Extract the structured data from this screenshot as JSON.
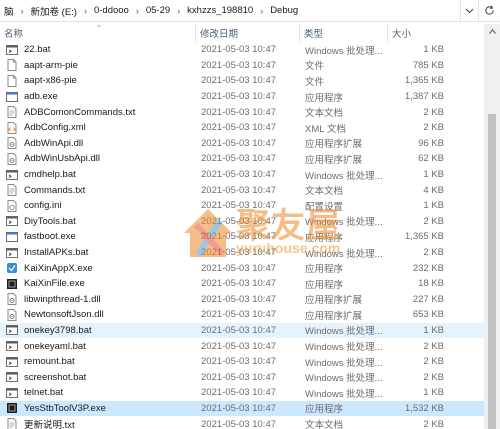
{
  "address": {
    "crumbs": [
      "脑",
      "新加卷 (E:)",
      "0-ddooo",
      "05-29",
      "kxhzzs_198810",
      "Debug"
    ]
  },
  "columns": {
    "name": "名称",
    "date": "修改日期",
    "type": "类型",
    "size": "大小"
  },
  "files": [
    {
      "name": "22.bat",
      "date": "2021-05-03 10:47",
      "type": "Windows 批处理...",
      "size": "1 KB",
      "icon": "bat-icon"
    },
    {
      "name": "aapt-arm-pie",
      "date": "2021-05-03 10:47",
      "type": "文件",
      "size": "785 KB",
      "icon": "blank-file-icon"
    },
    {
      "name": "aapt-x86-pie",
      "date": "2021-05-03 10:47",
      "type": "文件",
      "size": "1,365 KB",
      "icon": "blank-file-icon"
    },
    {
      "name": "adb.exe",
      "date": "2021-05-03 10:47",
      "type": "应用程序",
      "size": "1,387 KB",
      "icon": "exe-icon"
    },
    {
      "name": "ADBComonCommands.txt",
      "date": "2021-05-03 10:47",
      "type": "文本文档",
      "size": "2 KB",
      "icon": "text-file-icon"
    },
    {
      "name": "AdbConfig.xml",
      "date": "2021-05-03 10:47",
      "type": "XML 文档",
      "size": "2 KB",
      "icon": "xml-file-icon"
    },
    {
      "name": "AdbWinApi.dll",
      "date": "2021-05-03 10:47",
      "type": "应用程序扩展",
      "size": "96 KB",
      "icon": "dll-icon"
    },
    {
      "name": "AdbWinUsbApi.dll",
      "date": "2021-05-03 10:47",
      "type": "应用程序扩展",
      "size": "62 KB",
      "icon": "dll-icon"
    },
    {
      "name": "cmdhelp.bat",
      "date": "2021-05-03 10:47",
      "type": "Windows 批处理...",
      "size": "1 KB",
      "icon": "bat-icon"
    },
    {
      "name": "Commands.txt",
      "date": "2021-05-03 10:47",
      "type": "文本文档",
      "size": "4 KB",
      "icon": "text-file-icon"
    },
    {
      "name": "config.ini",
      "date": "2021-05-03 10:47",
      "type": "配置设置",
      "size": "1 KB",
      "icon": "ini-file-icon"
    },
    {
      "name": "DiyTools.bat",
      "date": "2021-05-03 10:47",
      "type": "Windows 批处理...",
      "size": "2 KB",
      "icon": "bat-icon"
    },
    {
      "name": "fastboot.exe",
      "date": "2021-05-03 10:47",
      "type": "应用程序",
      "size": "1,365 KB",
      "icon": "exe-icon"
    },
    {
      "name": "InstallAPKs.bat",
      "date": "2021-05-03 10:47",
      "type": "Windows 批处理...",
      "size": "2 KB",
      "icon": "bat-icon"
    },
    {
      "name": "KaiXinAppX.exe",
      "date": "2021-05-03 10:47",
      "type": "应用程序",
      "size": "232 KB",
      "icon": "app-icon"
    },
    {
      "name": "KaiXinFile.exe",
      "date": "2021-05-03 10:47",
      "type": "应用程序",
      "size": "18 KB",
      "icon": "dark-app-icon"
    },
    {
      "name": "libwinpthread-1.dll",
      "date": "2021-05-03 10:47",
      "type": "应用程序扩展",
      "size": "227 KB",
      "icon": "dll-icon"
    },
    {
      "name": "NewtonsoftJson.dll",
      "date": "2021-05-03 10:47",
      "type": "应用程序扩展",
      "size": "653 KB",
      "icon": "dll-icon"
    },
    {
      "name": "onekey3798.bat",
      "date": "2021-05-03 10:47",
      "type": "Windows 批处理...",
      "size": "1 KB",
      "icon": "bat-icon"
    },
    {
      "name": "onekeyaml.bat",
      "date": "2021-05-03 10:47",
      "type": "Windows 批处理...",
      "size": "2 KB",
      "icon": "bat-icon"
    },
    {
      "name": "remount.bat",
      "date": "2021-05-03 10:47",
      "type": "Windows 批处理...",
      "size": "2 KB",
      "icon": "bat-icon"
    },
    {
      "name": "screenshot.bat",
      "date": "2021-05-03 10:47",
      "type": "Windows 批处理...",
      "size": "2 KB",
      "icon": "bat-icon"
    },
    {
      "name": "telnet.bat",
      "date": "2021-05-03 10:47",
      "type": "Windows 批处理...",
      "size": "1 KB",
      "icon": "bat-icon"
    },
    {
      "name": "YesStbToolV3P.exe",
      "date": "2021-05-03 10:47",
      "type": "应用程序",
      "size": "1,532 KB",
      "icon": "dark-app-icon"
    },
    {
      "name": "更新说明.txt",
      "date": "2021-05-03 10:47",
      "type": "文本文档",
      "size": "2 KB",
      "icon": "text-file-icon"
    }
  ],
  "watermark": {
    "brand": "聚友屋",
    "url": "yuruhouse.com"
  },
  "colors": {
    "selected_row": "#cce8ff",
    "hover_row": "#e5f3ff",
    "header_text": "#4c607a",
    "secondary_text": "#6d6d6d"
  }
}
